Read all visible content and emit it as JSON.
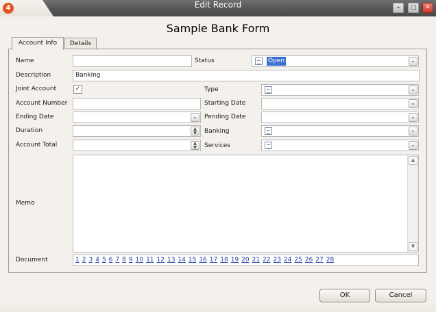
{
  "window": {
    "title": "Edit Record",
    "app_icon_glyph": "4"
  },
  "form": {
    "heading": "Sample Bank Form"
  },
  "tabs": [
    {
      "label": "Account Info",
      "active": true
    },
    {
      "label": "Details",
      "active": false
    }
  ],
  "fields": {
    "name": {
      "label": "Name",
      "value": ""
    },
    "description": {
      "label": "Description",
      "value": "Banking"
    },
    "joint_account": {
      "label": "Joint Account",
      "checked": true
    },
    "account_number": {
      "label": "Account Number",
      "value": ""
    },
    "ending_date": {
      "label": "Ending Date",
      "value": ""
    },
    "duration": {
      "label": "Duration",
      "value": ""
    },
    "account_total": {
      "label": "Account Total",
      "value": ""
    },
    "status": {
      "label": "Status",
      "value": "Open"
    },
    "type": {
      "label": "Type",
      "value": ""
    },
    "starting_date": {
      "label": "Starting Date",
      "value": ""
    },
    "pending_date": {
      "label": "Pending Date",
      "value": ""
    },
    "banking": {
      "label": "Banking",
      "value": ""
    },
    "services": {
      "label": "Services",
      "value": ""
    },
    "memo": {
      "label": "Memo",
      "value": ""
    },
    "document": {
      "label": "Document",
      "links": [
        "1",
        "2",
        "3",
        "4",
        "5",
        "6",
        "7",
        "8",
        "9",
        "10",
        "11",
        "12",
        "13",
        "14",
        "15",
        "16",
        "17",
        "18",
        "19",
        "20",
        "21",
        "22",
        "23",
        "24",
        "25",
        "26",
        "27",
        "28"
      ]
    }
  },
  "buttons": {
    "ok": "OK",
    "cancel": "Cancel"
  },
  "window_buttons": {
    "minimize": "–",
    "maximize": "□",
    "close": "✕"
  },
  "icons": {
    "dropdown": "⌄",
    "spin_up": "▲",
    "spin_down": "▼",
    "check": "✓",
    "scroll_up": "▲",
    "scroll_down": "▼"
  },
  "colors": {
    "titlebar": "#565656",
    "selection": "#3d6fd3",
    "close_button": "#c9382a",
    "link": "#1f3fa0"
  }
}
